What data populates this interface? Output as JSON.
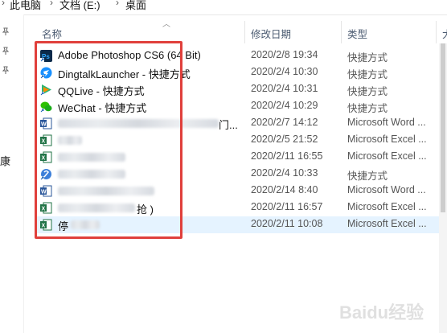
{
  "breadcrumb": {
    "items": [
      "此电脑",
      "文档 (E:)",
      "桌面"
    ],
    "separator": "›"
  },
  "nav": {
    "fragment": "康"
  },
  "columns": {
    "name": "名称",
    "date": "修改日期",
    "type": "类型",
    "extra": "大"
  },
  "files": [
    {
      "name": "Adobe Photoshop CS6 (64 Bit)",
      "date": "2020/2/8 19:34",
      "type": "快捷方式",
      "icon": "photoshop-shortcut-icon"
    },
    {
      "name": "DingtalkLauncher - 快捷方式",
      "date": "2020/2/4 10:30",
      "type": "快捷方式",
      "icon": "dingtalk-shortcut-icon"
    },
    {
      "name": "QQLive - 快捷方式",
      "date": "2020/2/4 10:31",
      "type": "快捷方式",
      "icon": "qqlive-shortcut-icon"
    },
    {
      "name": "WeChat - 快捷方式",
      "date": "2020/2/4 10:29",
      "type": "快捷方式",
      "icon": "wechat-shortcut-icon"
    },
    {
      "name": "",
      "name_tail": "门...",
      "date": "2020/2/7 14:12",
      "type": "Microsoft Word ...",
      "icon": "word-document-icon"
    },
    {
      "name": "",
      "date": "2020/2/5 21:52",
      "type": "Microsoft Excel ...",
      "icon": "excel-document-icon"
    },
    {
      "name": "",
      "date": "2020/2/11 16:55",
      "type": "Microsoft Excel ...",
      "icon": "excel-document-icon"
    },
    {
      "name": "",
      "date": "2020/2/4 10:33",
      "type": "快捷方式",
      "icon": "generic-shortcut-icon"
    },
    {
      "name": "",
      "date": "2020/2/14 8:40",
      "type": "Microsoft Word ...",
      "icon": "word-document-icon"
    },
    {
      "name": "",
      "name_tail": "抢 )",
      "date": "2020/2/11 16:57",
      "type": "Microsoft Excel ...",
      "icon": "excel-document-icon"
    },
    {
      "name": "",
      "name_head": "停",
      "date": "2020/2/11 10:08",
      "type": "Microsoft Excel ...",
      "icon": "excel-document-icon",
      "selected": true
    }
  ],
  "colors": {
    "highlight_border": "#e0403c",
    "selected_row": "#e5f3ff",
    "header_text": "#4a5a70",
    "word_blue": "#2b579a",
    "excel_green": "#217346"
  },
  "watermark": {
    "text": "Baidu经验"
  }
}
